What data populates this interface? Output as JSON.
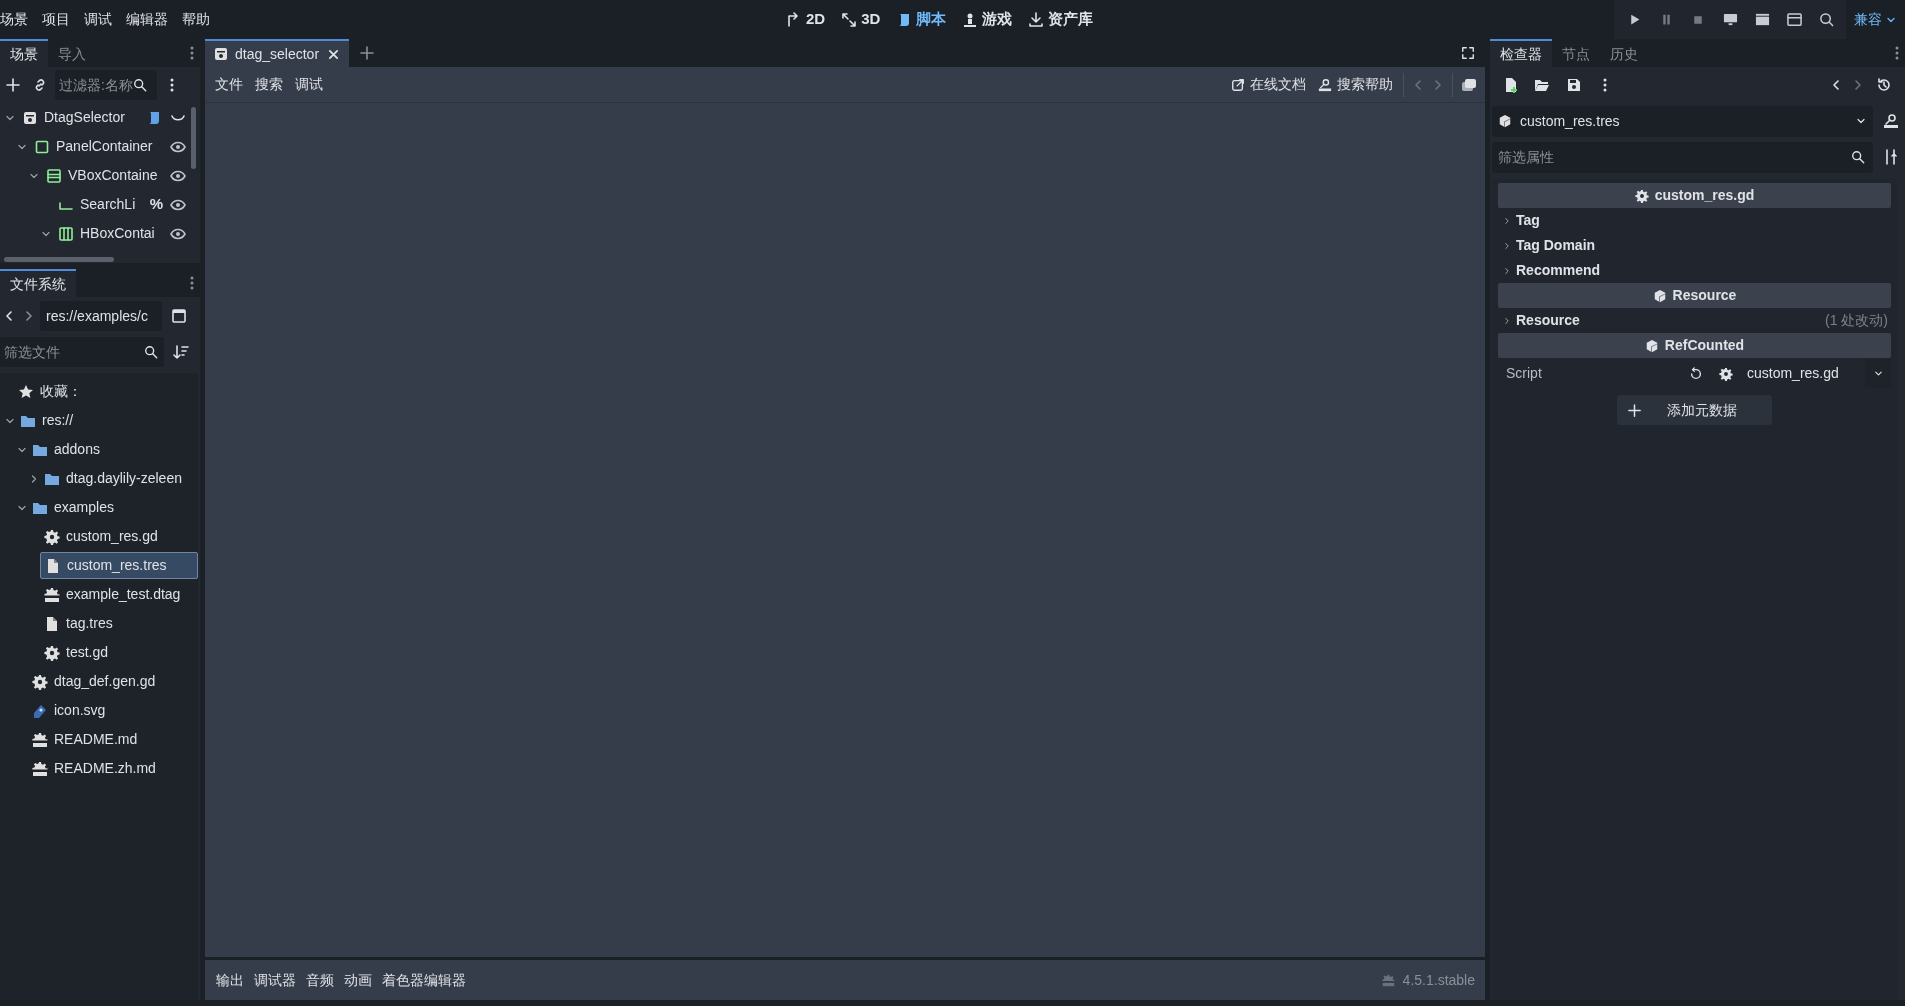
{
  "menu": [
    "场景",
    "项目",
    "调试",
    "编辑器",
    "帮助"
  ],
  "workspaces": [
    {
      "label": "2D",
      "kind": "move",
      "selected": false
    },
    {
      "label": "3D",
      "kind": "rotate",
      "selected": false
    },
    {
      "label": "脚本",
      "kind": "script",
      "selected": true
    },
    {
      "label": "游戏",
      "kind": "game",
      "selected": false
    },
    {
      "label": "资产库",
      "kind": "assets",
      "selected": false
    }
  ],
  "renderer": "兼容",
  "scene_dock": {
    "tabs": [
      {
        "label": "场景",
        "selected": true
      },
      {
        "label": "导入",
        "selected": false
      }
    ],
    "filter": {
      "placeholder": "过滤器:名称"
    },
    "tree": [
      {
        "name": "DtagSelector",
        "kind": "root",
        "expanded": true,
        "children": [
          {
            "name": "PanelContainer",
            "kind": "panel",
            "expanded": true,
            "children": [
              {
                "name": "VBoxContaine",
                "kind": "vbox",
                "expanded": true,
                "children": [
                  {
                    "name": "SearchLi",
                    "kind": "line",
                    "unique_mark": "%"
                  },
                  {
                    "name": "HBoxContai",
                    "kind": "hbox",
                    "expanded": true
                  }
                ]
              }
            ]
          }
        ]
      }
    ]
  },
  "filesystem": {
    "tabs": [
      {
        "label": "文件系统",
        "selected": true
      }
    ],
    "path": "res://examples/c",
    "filter": {
      "placeholder": "筛选文件"
    },
    "favorites": "收藏：",
    "tree": [
      {
        "name": "res://",
        "kind": "folder",
        "expanded": true,
        "selected": false,
        "children": [
          {
            "name": "addons",
            "kind": "folder",
            "expanded": true,
            "selected": false,
            "children": [
              {
                "name": "dtag.daylily-zeleen",
                "kind": "folder",
                "expanded": false,
                "selected": false
              }
            ]
          },
          {
            "name": "examples",
            "kind": "folder",
            "expanded": true,
            "selected": false,
            "children": [
              {
                "name": "custom_res.gd",
                "kind": "script",
                "selected": false
              },
              {
                "name": "custom_res.tres",
                "kind": "resource",
                "selected": true
              },
              {
                "name": "example_test.dtag",
                "kind": "text",
                "selected": false
              },
              {
                "name": "tag.tres",
                "kind": "resource",
                "selected": false
              },
              {
                "name": "test.gd",
                "kind": "script",
                "selected": false
              }
            ]
          },
          {
            "name": "dtag_def.gen.gd",
            "kind": "script",
            "selected": false
          },
          {
            "name": "icon.svg",
            "kind": "image",
            "selected": false
          },
          {
            "name": "README.md",
            "kind": "text",
            "selected": false
          },
          {
            "name": "README.zh.md",
            "kind": "text",
            "selected": false
          }
        ]
      }
    ]
  },
  "script_editor": {
    "tabs": [
      {
        "label": "dtag_selector",
        "selected": true
      }
    ],
    "menu": [
      "文件",
      "搜索",
      "调试"
    ],
    "links": [
      {
        "label": "在线文档",
        "kind": "docs"
      },
      {
        "label": "搜索帮助",
        "kind": "search"
      }
    ]
  },
  "bottom_panel": {
    "tabs": [
      "输出",
      "调试器",
      "音频",
      "动画",
      "着色器编辑器"
    ],
    "version": "4.5.1.stable"
  },
  "inspector": {
    "tabs": [
      {
        "label": "检查器",
        "selected": true
      },
      {
        "label": "节点",
        "selected": false
      },
      {
        "label": "历史",
        "selected": false
      }
    ],
    "resource": "custom_res.tres",
    "filter": {
      "placeholder": "筛选属性"
    },
    "rows": [
      {
        "kind": "header",
        "label": "custom_res.gd"
      },
      {
        "kind": "group",
        "label": "Tag"
      },
      {
        "kind": "group",
        "label": "Tag Domain"
      },
      {
        "kind": "group",
        "label": "Recommend"
      },
      {
        "kind": "header",
        "label": "Resource"
      },
      {
        "kind": "group",
        "label": "Resource",
        "note": "(1 处改动)"
      },
      {
        "kind": "header",
        "label": "RefCounted"
      },
      {
        "kind": "property",
        "label": "Script",
        "value": "custom_res.gd"
      }
    ],
    "add_metadata": "添加元数据"
  }
}
